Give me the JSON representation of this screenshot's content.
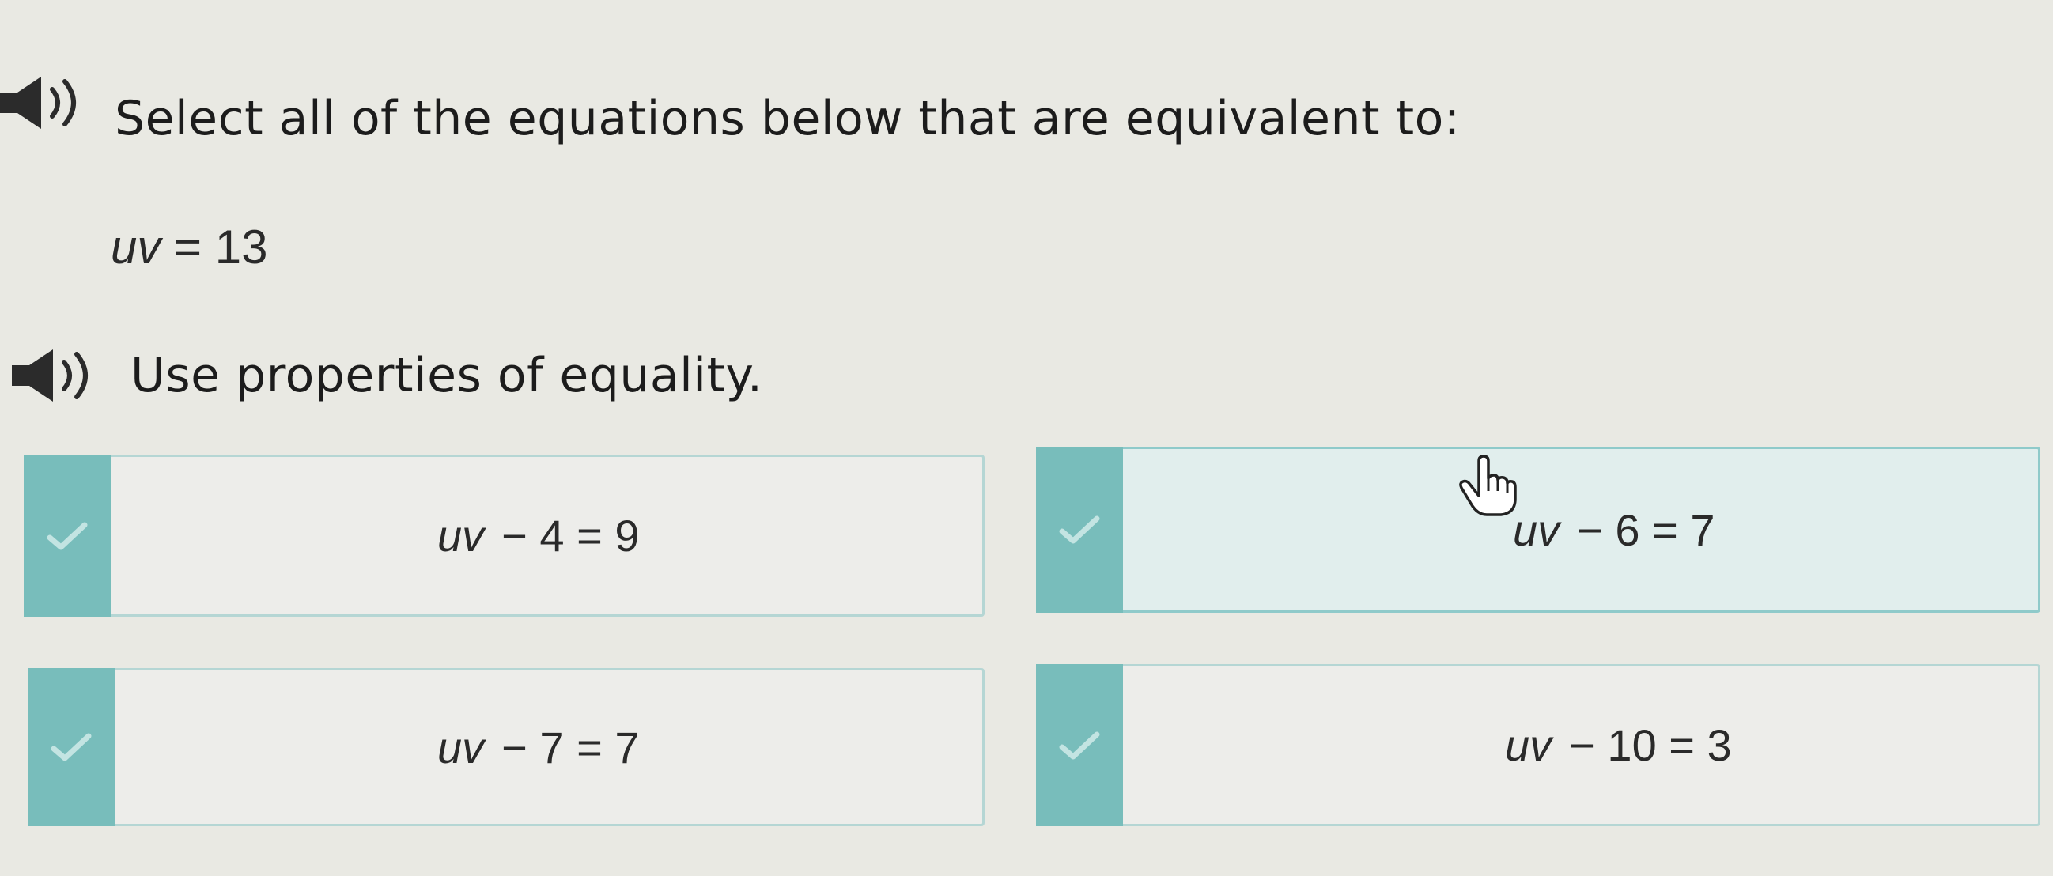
{
  "question": {
    "instruction": "Select all of the equations below that are equivalent to:",
    "equation": {
      "variable": "uv",
      "rest": "= 13"
    },
    "hint": "Use properties of equality."
  },
  "icons": {
    "speaker": "speaker-icon",
    "check": "checkmark-icon",
    "cursor": "hand-pointer-icon"
  },
  "colors": {
    "check_tab": "#78bdbb",
    "choice_border": "#b5d6d4",
    "selected_border": "#8fcaca",
    "background": "#e9e9e3"
  },
  "choices": [
    {
      "variable": "uv",
      "rest": "− 4 = 9",
      "selected": false
    },
    {
      "variable": "uv",
      "rest": "− 6 = 7",
      "selected": true
    },
    {
      "variable": "uv",
      "rest": "− 7 = 7",
      "selected": false
    },
    {
      "variable": "uv",
      "rest": "− 10 = 3",
      "selected": false
    }
  ]
}
